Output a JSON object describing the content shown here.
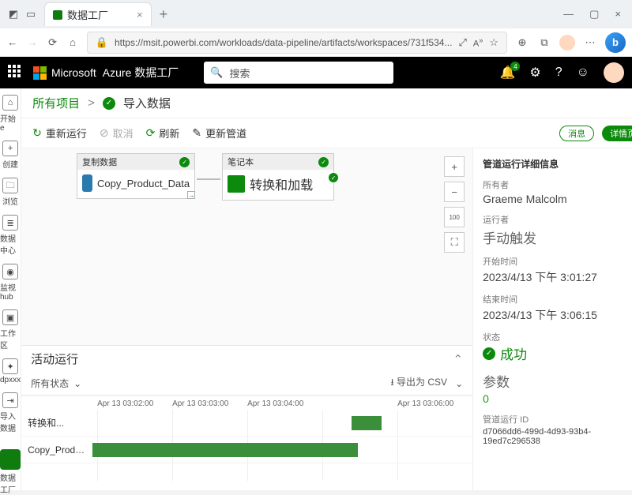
{
  "browser": {
    "tab_title": "数据工厂",
    "url": "https://msit.powerbi.com/workloads/data-pipeline/artifacts/workspaces/731f534..."
  },
  "azure": {
    "brand": "Microsoft",
    "product": "Azure 数据工厂",
    "search_placeholder": "搜索",
    "notif_count": "4"
  },
  "leftnav": {
    "items": [
      "开始 e",
      "创建",
      "浏览",
      "数据中心",
      "监视hub",
      "工作区",
      "dpxxx",
      "导入数据"
    ],
    "footer": "数据工厂"
  },
  "crumb": {
    "all": "所有项目",
    "arrow": ">",
    "page": "导入数据"
  },
  "tools": {
    "rerun": "重新运行",
    "cancel": "取消",
    "refresh": "刷新",
    "update": "更新管道",
    "pill_a": "消息",
    "pill_b": "详情页"
  },
  "canvas": {
    "n1_head": "复制数据",
    "n1_body": "Copy_Product_Data",
    "n2_head": "笔记本",
    "n2_body": "转换和加载"
  },
  "activity": {
    "title": "活动运行",
    "filter": "所有状态",
    "csv": "导出为 CSV"
  },
  "gantt": {
    "times": [
      "Apr 13 03:02:00",
      "Apr 13 03:03:00",
      "Apr 13 03:04:00",
      "",
      "Apr 13 03:06:00"
    ],
    "rows": [
      "转换和...",
      "Copy_Product..."
    ]
  },
  "details": {
    "title": "管道运行详细信息",
    "owner_l": "所有者",
    "owner_v": "Graeme Malcolm",
    "runner_l": "运行者",
    "runner_v": "手动触发",
    "start_l": "开始时间",
    "start_v": "2023/4/13 下午 3:01:27",
    "end_l": "结束时间",
    "end_v": "2023/4/13 下午 3:06:15",
    "status_l": "状态",
    "status_v": "成功",
    "params_l": "参数",
    "params_v": "0",
    "runid_l": "管道运行 ID",
    "runid_v": "d7066dd6-499d-4d93-93b4-19ed7c296538"
  }
}
